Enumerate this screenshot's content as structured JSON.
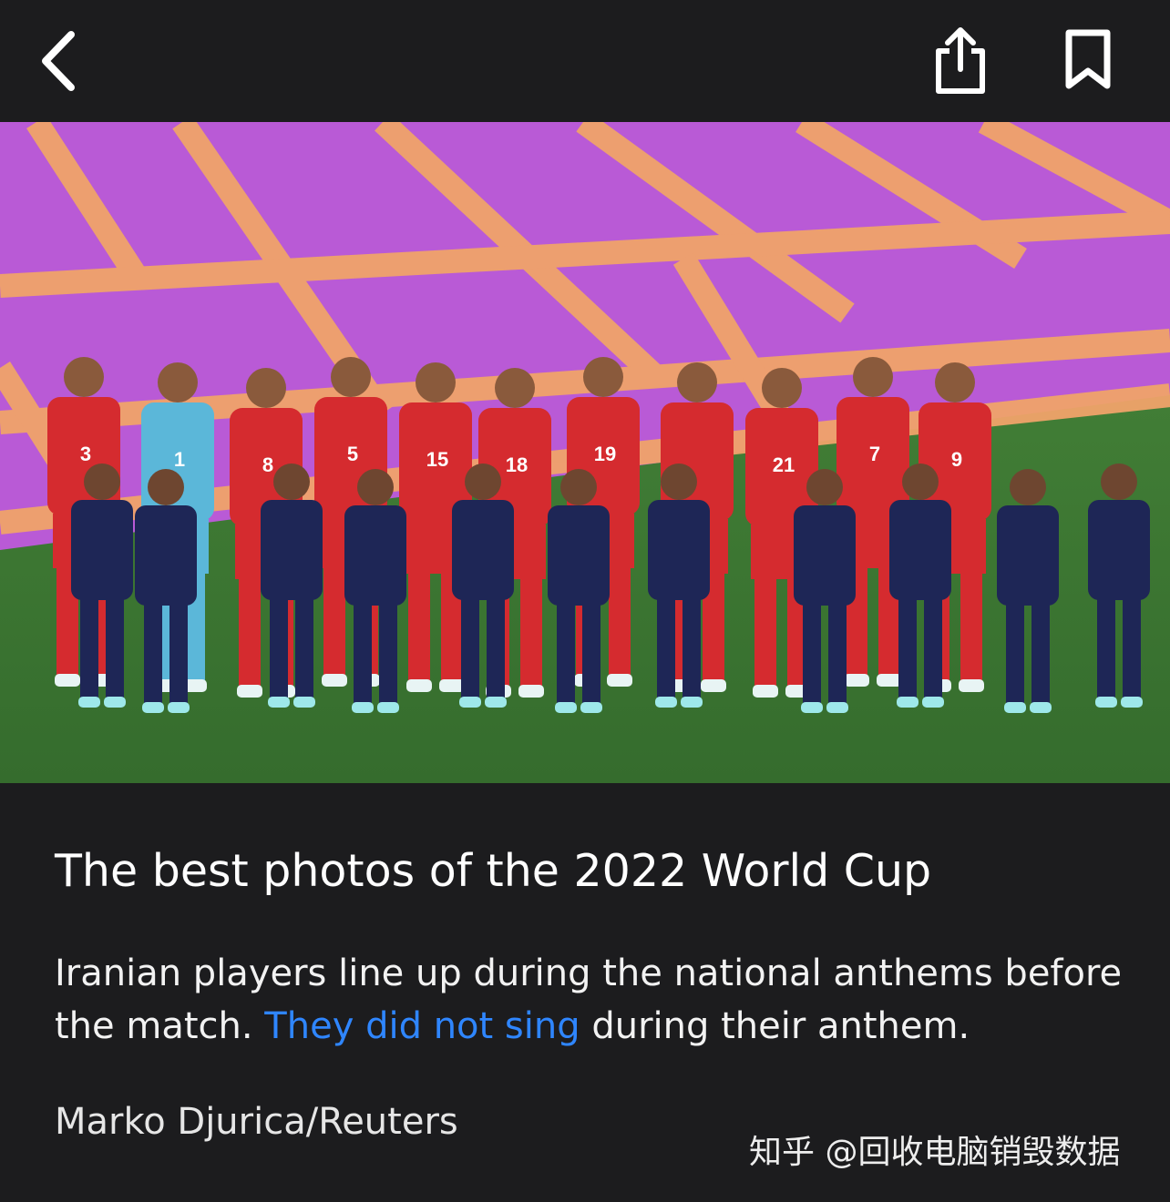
{
  "toolbar": {
    "back_icon": "chevron-left-icon",
    "share_icon": "share-icon",
    "bookmark_icon": "bookmark-icon"
  },
  "photo": {
    "jersey_numbers": [
      "3",
      "1",
      "8",
      "5",
      "15",
      "18",
      "19",
      "21",
      "7",
      "9"
    ],
    "colors": {
      "pitch_purple": "#b95ad6",
      "pitch_orange": "#f0a36a",
      "grass": "#3f7d35",
      "kit_red": "#d52b2f",
      "keeper_blue": "#5bb7d9",
      "child_navy": "#1e2656"
    }
  },
  "article": {
    "title": "The best photos of the 2022 World Cup",
    "caption_before": "Iranian players line up during the national anthems before the match. ",
    "caption_link": "They did not sing",
    "caption_after": " during their anthem.",
    "credit": "Marko Djurica/Reuters"
  },
  "watermark": {
    "text": "知乎 @回收电脑销毁数据"
  },
  "colors": {
    "background": "#1c1c1e",
    "link": "#2f86ff",
    "text": "#ffffff"
  }
}
